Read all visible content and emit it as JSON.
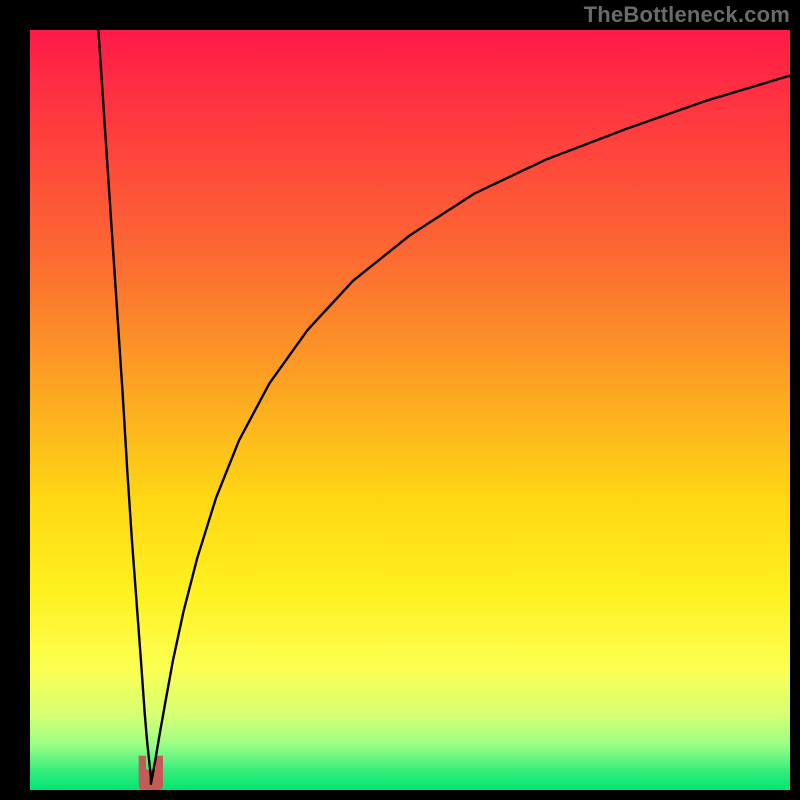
{
  "watermark": "TheBottleneck.com",
  "frame": {
    "outer_w": 800,
    "outer_h": 800,
    "inner_left": 30,
    "inner_top": 30,
    "inner_w": 760,
    "inner_h": 760,
    "border_color": "#000000"
  },
  "gradient": {
    "stops": [
      {
        "offset": 0.0,
        "color": "#ff1a49"
      },
      {
        "offset": 0.12,
        "color": "#ff3a3f"
      },
      {
        "offset": 0.3,
        "color": "#fc6a32"
      },
      {
        "offset": 0.48,
        "color": "#fca821"
      },
      {
        "offset": 0.62,
        "color": "#ffd814"
      },
      {
        "offset": 0.74,
        "color": "#fff120"
      },
      {
        "offset": 0.84,
        "color": "#fcff52"
      },
      {
        "offset": 0.9,
        "color": "#d8ff73"
      },
      {
        "offset": 0.94,
        "color": "#9cff86"
      },
      {
        "offset": 0.975,
        "color": "#34ed7a"
      },
      {
        "offset": 1.0,
        "color": "#00e676"
      }
    ]
  },
  "cusp_marker": {
    "color": "#c65a56",
    "x_center_frac": 0.159,
    "y_top_frac": 0.955,
    "width_frac": 0.032,
    "height_frac": 0.045
  },
  "chart_data": {
    "type": "line",
    "title": "",
    "xlabel": "",
    "ylabel": "",
    "xlim": [
      0,
      100
    ],
    "ylim": [
      0,
      100
    ],
    "note": "No axis ticks or labels are rendered; x and y are normalized 0–100 left→right and bottom→top. The curve has a cusp near x≈16 touching y≈0, rises steeply on both sides; the left branch reaches y=100 at x≈9 and the right branch reaches y≈94 at x=100.",
    "series": [
      {
        "name": "left-branch",
        "x": [
          9.0,
          9.8,
          10.6,
          11.4,
          12.2,
          12.8,
          13.4,
          14.0,
          14.6,
          15.1,
          15.4,
          15.7,
          15.9
        ],
        "y": [
          100,
          88,
          76,
          64,
          52,
          42,
          33,
          25,
          17,
          10,
          6.5,
          3.6,
          1.8
        ]
      },
      {
        "name": "right-branch",
        "x": [
          16.1,
          16.5,
          17.0,
          17.8,
          18.8,
          20.2,
          22.0,
          24.5,
          27.5,
          31.5,
          36.5,
          42.5,
          50.0,
          58.5,
          68.0,
          78.5,
          89.0,
          100.0
        ],
        "y": [
          1.8,
          4.0,
          7.0,
          11.5,
          17.0,
          23.5,
          30.5,
          38.5,
          46.0,
          53.5,
          60.5,
          67.0,
          73.0,
          78.5,
          83.0,
          87.0,
          90.7,
          94.0
        ]
      }
    ],
    "cusp": {
      "x": 15.9,
      "y": 0.8
    }
  }
}
